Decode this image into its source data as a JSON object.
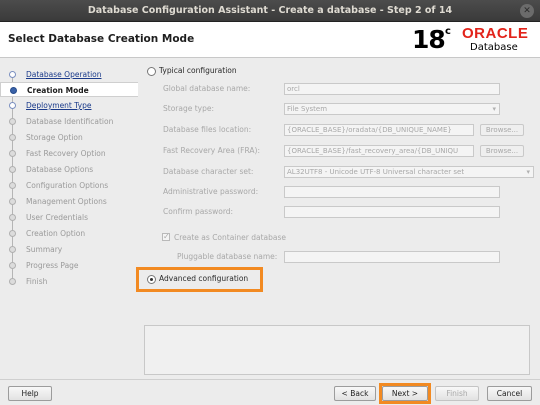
{
  "window": {
    "title": "Database Configuration Assistant - Create a database - Step 2 of 14",
    "close_glyph": "✕"
  },
  "header": {
    "page_title": "Select Database Creation Mode",
    "logo": {
      "version": "18",
      "version_sup": "c",
      "brand": "ORACLE",
      "product": "Database",
      "brand_color": "#e2231a"
    }
  },
  "nav": {
    "items": [
      {
        "label": "Database Operation",
        "state": "done"
      },
      {
        "label": "Creation Mode",
        "state": "current"
      },
      {
        "label": "Deployment Type",
        "state": "done"
      },
      {
        "label": "Database Identification",
        "state": "pending"
      },
      {
        "label": "Storage Option",
        "state": "pending"
      },
      {
        "label": "Fast Recovery Option",
        "state": "pending"
      },
      {
        "label": "Database Options",
        "state": "pending"
      },
      {
        "label": "Configuration Options",
        "state": "pending"
      },
      {
        "label": "Management Options",
        "state": "pending"
      },
      {
        "label": "User Credentials",
        "state": "pending"
      },
      {
        "label": "Creation Option",
        "state": "pending"
      },
      {
        "label": "Summary",
        "state": "pending"
      },
      {
        "label": "Progress Page",
        "state": "pending"
      },
      {
        "label": "Finish",
        "state": "pending"
      }
    ]
  },
  "typical": {
    "label": "Typical configuration",
    "selected": false,
    "global_db_name_label": "Global database name:",
    "global_db_name_value": "orcl",
    "storage_type_label": "Storage type:",
    "storage_type_value": "File System",
    "db_files_location_label": "Database files location:",
    "db_files_location_value": "{ORACLE_BASE}/oradata/{DB_UNIQUE_NAME}",
    "fra_label": "Fast Recovery Area (FRA):",
    "fra_value": "{ORACLE_BASE}/fast_recovery_area/{DB_UNIQU",
    "charset_label": "Database character set:",
    "charset_value": "AL32UTF8 - Unicode UTF-8 Universal character set",
    "admin_password_label": "Administrative password:",
    "confirm_password_label": "Confirm password:",
    "container_label": "Create as Container database",
    "container_checked": true,
    "pluggable_label": "Pluggable database name:",
    "browse_label": "Browse..."
  },
  "advanced": {
    "label": "Advanced configuration",
    "selected": true,
    "highlight_color": "#f28a22"
  },
  "footer": {
    "help": "Help",
    "back": "< Back",
    "next": "Next >",
    "finish": "Finish",
    "cancel": "Cancel"
  }
}
